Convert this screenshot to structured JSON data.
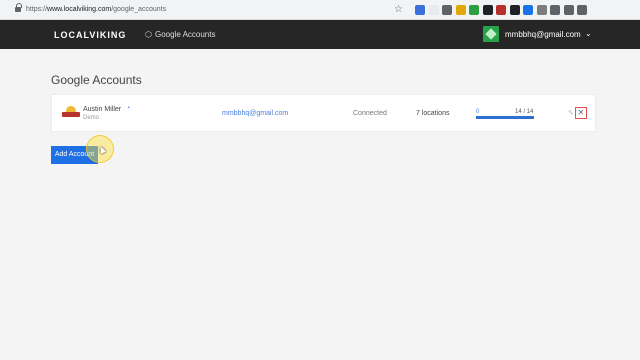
{
  "browser": {
    "url_scheme": "https://",
    "url_host": "www.localviking.com",
    "url_path": "/google_accounts",
    "extension_colors": [
      "#3b6fd9",
      "#e8eaed",
      "#5f6368",
      "#e0a800",
      "#2e9e43",
      "#202124",
      "#b5302b",
      "#202124",
      "#1a73e8",
      "#7d7d7d",
      "#5f6368",
      "#5f6368",
      "#5f6368"
    ]
  },
  "header": {
    "logo": "LOCALVIKING",
    "nav_icon": "google-icon",
    "nav_label": "Google Accounts",
    "user_email": "mmbbhq@gmail.com",
    "caret": "⌄"
  },
  "main": {
    "title": "Google Accounts",
    "accounts": [
      {
        "name": "Austin Miller",
        "subtitle": "Demo",
        "email": "mmbbhq@gmail.com",
        "status": "Connected",
        "locations": "7 locations",
        "progress_start": "0",
        "progress_count": "14 / 14",
        "progress_fraction": 1.0
      }
    ],
    "add_account_label": "Add Account"
  },
  "colors": {
    "header_bg": "#262626",
    "accent": "#1f6fe5",
    "link": "#4a7fdc",
    "remove_border": "#e05050"
  }
}
